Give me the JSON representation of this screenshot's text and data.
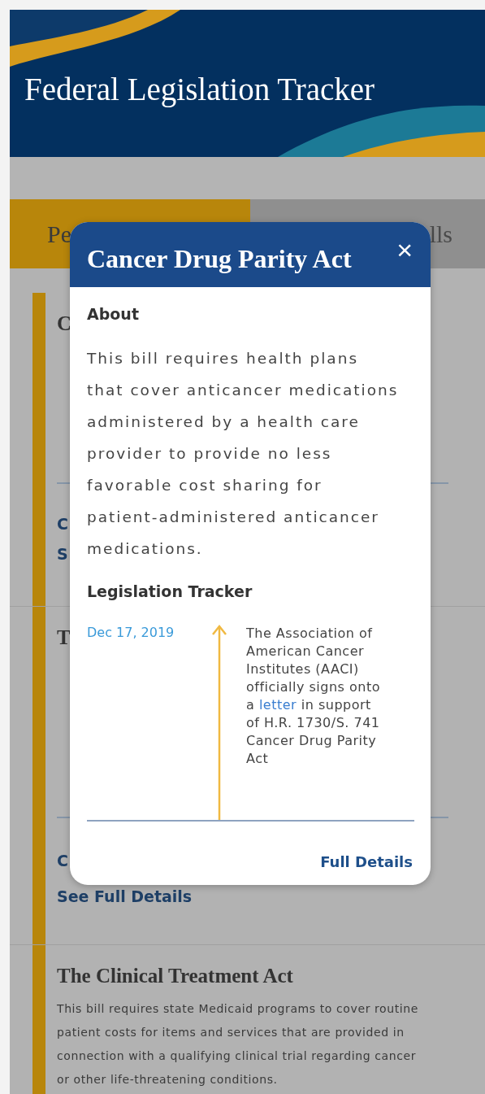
{
  "header": {
    "title": "Federal Legislation Tracker"
  },
  "tabs": [
    {
      "label": "Pe",
      "selected": true
    },
    {
      "label": "lls",
      "selected": false
    }
  ],
  "bills": [
    {
      "title": "C",
      "links": [
        "C",
        "S"
      ]
    },
    {
      "title": "T",
      "links": [
        "C",
        "See Full Details"
      ]
    },
    {
      "title": "The Clinical Treatment Act",
      "description": "This bill requires state Medicaid programs to cover routine patient costs for items and services that are provided in connection with a qualifying clinical trial regarding cancer or other life-threatening conditions."
    }
  ],
  "modal": {
    "title": "Cancer Drug Parity Act",
    "close": "×",
    "about_heading": "About",
    "about": "This bill requires health plans that cover anticancer medications administered by a health care provider to provide no less favorable cost sharing for patient-administered anticancer medications.",
    "tracker_heading": "Legislation Tracker",
    "events": [
      {
        "date": "Dec 17, 2019",
        "text_before": "The Association of American Cancer Institutes (AACI) officially signs onto a",
        "link": "letter",
        "text_after": "in support of H.R. 1730/S. 741 Cancer Drug Parity Act"
      }
    ],
    "footer_link": "Full Details"
  }
}
